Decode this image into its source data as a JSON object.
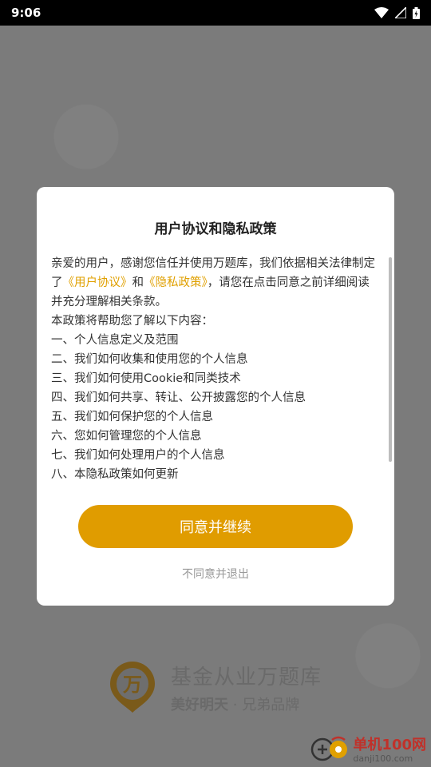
{
  "status_bar": {
    "time": "9:06",
    "icons": [
      "wifi-icon",
      "signal-icon",
      "battery-icon"
    ]
  },
  "dialog": {
    "title": "用户协议和隐私政策",
    "intro_before": "亲爱的用户，感谢您信任并使用万题库，我们依据相关法律制定了",
    "link_user_agreement": "《用户协议》",
    "intro_and": "和",
    "link_privacy_policy": "《隐私政策》",
    "intro_after": "，请您在点击同意之前详细阅读并充分理解相关条款。",
    "help_line": "本政策将帮助您了解以下内容：",
    "items": [
      "一、个人信息定义及范围",
      "二、我们如何收集和使用您的个人信息",
      "三、我们如何使用Cookie和同类技术",
      "四、我们如何共享、转让、公开披露您的个人信息",
      "五、我们如何保护您的个人信息",
      "六、您如何管理您的个人信息",
      "七、我们如何处理用户的个人信息",
      "八、本隐私政策如何更新"
    ],
    "agree_button": "同意并继续",
    "decline_button": "不同意并退出"
  },
  "brand": {
    "logo_char": "万",
    "name": "基金从业万题库",
    "slogan_bold": "美好明天",
    "slogan_sep": "·",
    "slogan_rest": "兄弟品牌"
  },
  "watermark": {
    "title": "单机100网",
    "url": "danji100.com"
  },
  "colors": {
    "accent": "#e09c00",
    "link": "#e0a000",
    "overlay": "#7b7b7b"
  }
}
